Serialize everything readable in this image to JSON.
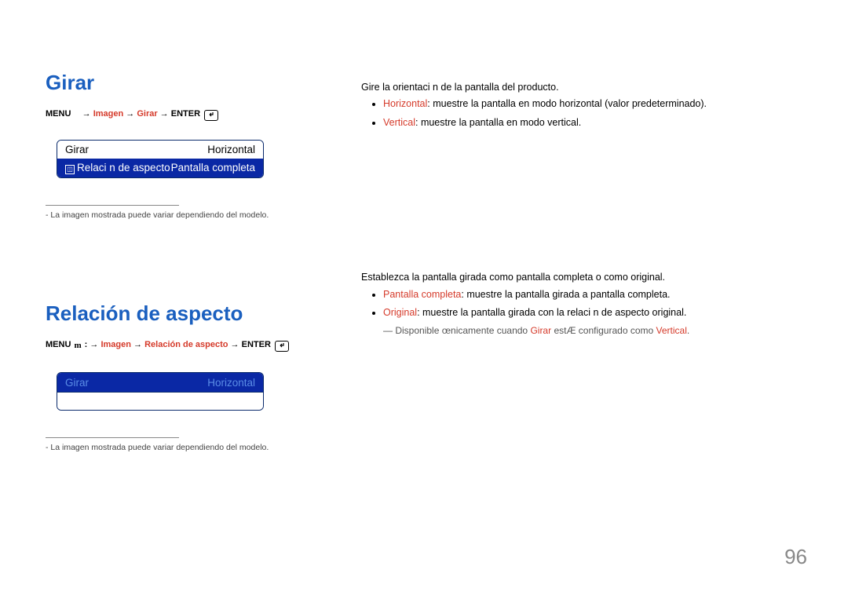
{
  "section1": {
    "title": "Girar",
    "menu": {
      "prefix": "MENU",
      "path1": "Imagen",
      "path2": "Girar",
      "enter": "ENTER"
    },
    "ui": {
      "row1_left": "Girar",
      "row1_right": "Horizontal",
      "row2_left": "Relaci n de aspecto",
      "row2_right": "Pantalla completa"
    },
    "footnote": "La imagen mostrada puede variar dependiendo del modelo.",
    "right": {
      "intro": "Gire la orientaci n de la pantalla del producto.",
      "items": [
        {
          "label": "Horizontal",
          "text": ": muestre la pantalla en modo horizontal (valor predeterminado)."
        },
        {
          "label": "Vertical",
          "text": ": muestre la pantalla en modo vertical."
        }
      ]
    }
  },
  "section2": {
    "title": "Relación de aspecto",
    "menu": {
      "prefix": "MENU",
      "path1": "Imagen",
      "path2": "Relación de aspecto",
      "enter": "ENTER"
    },
    "ui": {
      "row1_left": "Girar",
      "row1_right": "Horizontal"
    },
    "footnote": "La imagen mostrada puede variar dependiendo del modelo.",
    "right": {
      "intro": "Establezca la pantalla girada como pantalla completa o como original.",
      "items": [
        {
          "label": "Pantalla completa",
          "text": ": muestre la pantalla girada a pantalla completa."
        },
        {
          "label": "Original",
          "text": ": muestre la pantalla girada con la relaci n de aspecto original."
        }
      ],
      "note_pre": "― Disponible œnicamente cuando ",
      "note_mid1": "Girar",
      "note_mid2": " estÆ configurado como ",
      "note_mid3": "Vertical",
      "note_end": "."
    }
  },
  "page_number": "96"
}
